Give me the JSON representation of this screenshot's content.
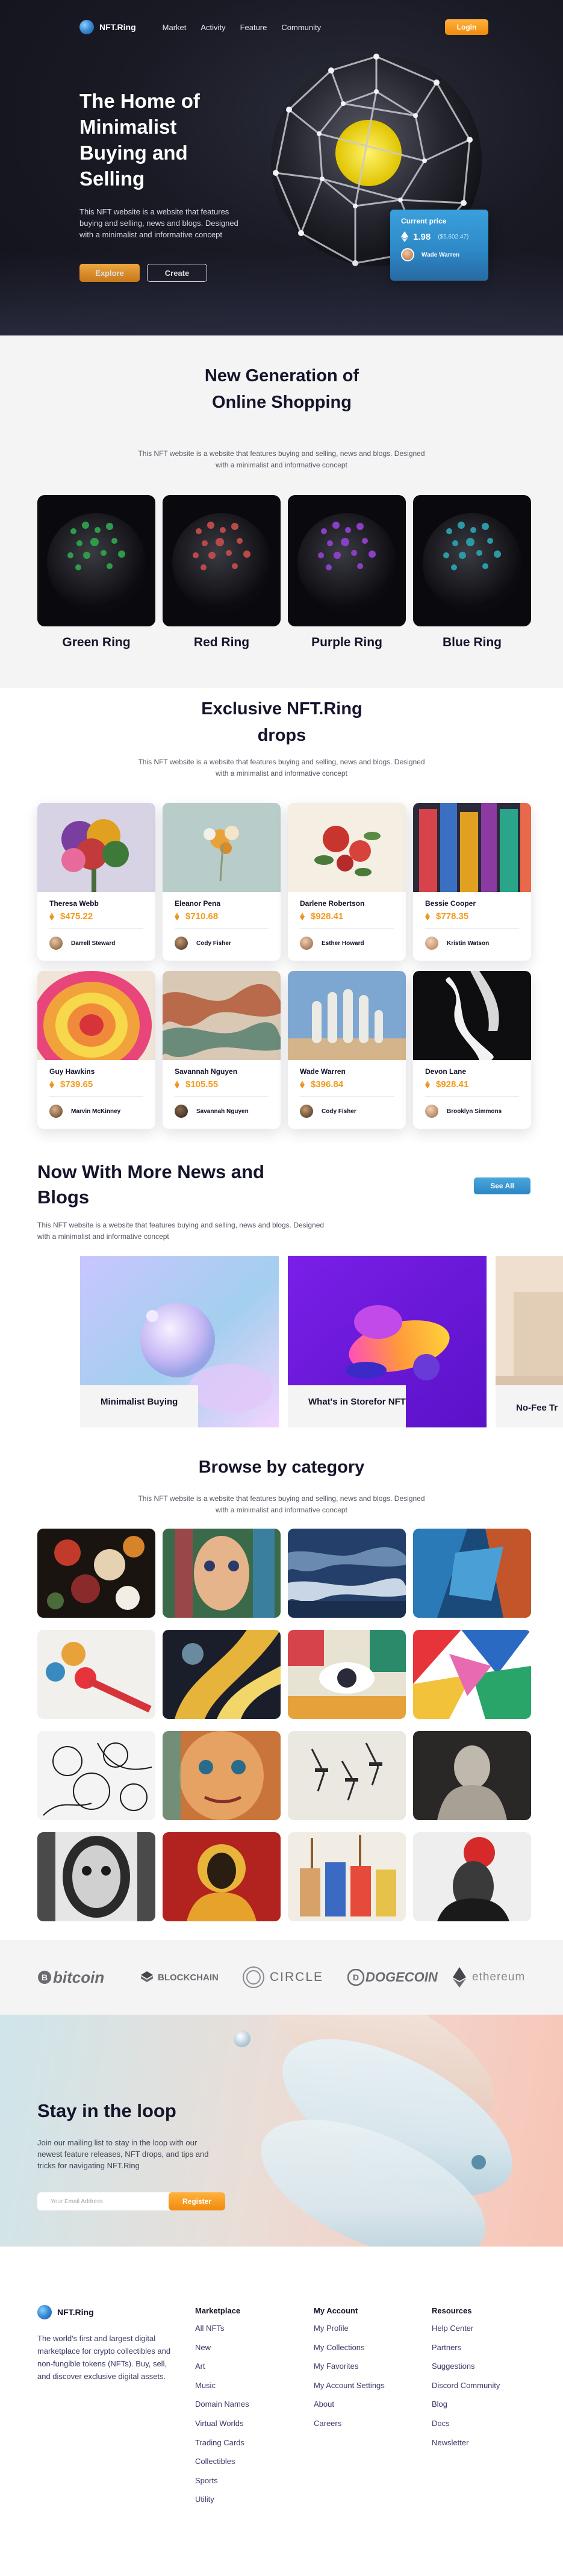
{
  "nav": {
    "brand": "NFT.Ring",
    "links": [
      "Market",
      "Activity",
      "Feature",
      "Community"
    ],
    "login": "Login"
  },
  "hero": {
    "title": "The Home of Minimalist Buying and Selling",
    "description": "This NFT website is a website that features buying and selling, news and blogs. Designed with a minimalist and informative concept",
    "explore": "Explore",
    "create": "Create",
    "price_card": {
      "label": "Current price",
      "eth": "1.98",
      "usd": "($5,602.47)",
      "owner": "Wade Warren"
    }
  },
  "new_generation": {
    "title": "New Generation of Online Shopping",
    "description": "This NFT website is a website that features buying and selling, news and blogs. Designed with a minimalist and informative concept",
    "rings": [
      {
        "name": "Green Ring",
        "color": "#2f9a4a"
      },
      {
        "name": "Red Ring",
        "color": "#b94a4a"
      },
      {
        "name": "Purple Ring",
        "color": "#8a3fc4"
      },
      {
        "name": "Blue Ring",
        "color": "#2a9aa5"
      }
    ]
  },
  "drops": {
    "title": "Exclusive NFT.Ring drops",
    "description": "This NFT website is a website that features buying and selling, news and blogs. Designed with a minimalist and informative concept",
    "items": [
      {
        "name": "Theresa Webb",
        "price": "$475.22",
        "owner": "Darrell Steward"
      },
      {
        "name": "Eleanor Pena",
        "price": "$710.68",
        "owner": "Cody Fisher"
      },
      {
        "name": "Darlene Robertson",
        "price": "$928.41",
        "owner": "Esther Howard"
      },
      {
        "name": "Bessie Cooper",
        "price": "$778.35",
        "owner": "Kristin Watson"
      },
      {
        "name": "Guy Hawkins",
        "price": "$739.65",
        "owner": "Marvin McKinney"
      },
      {
        "name": "Savannah Nguyen",
        "price": "$105.55",
        "owner": "Savannah Nguyen"
      },
      {
        "name": "Wade Warren",
        "price": "$396.84",
        "owner": "Cody Fisher"
      },
      {
        "name": "Devon Lane",
        "price": "$928.41",
        "owner": "Brooklyn Simmons"
      }
    ]
  },
  "news": {
    "title": "Now With More News and Blogs",
    "description": "This NFT website is a website that features buying and selling, news and blogs. Designed with a minimalist and informative concept",
    "see_all": "See All",
    "cards": [
      "Minimalist Buying",
      "What's in Storefor NFT",
      "No-Fee Tr"
    ]
  },
  "category": {
    "title": "Browse by category",
    "description": "This NFT website is a website that features buying and selling, news and blogs. Designed with a minimalist and informative concept"
  },
  "brands": [
    "bitcoin",
    "BLOCKCHAIN",
    "CIRCLE",
    "DOGECOIN",
    "ethereum"
  ],
  "loop": {
    "title": "Stay in the loop",
    "description": "Join our mailing list to stay in the loop with our newest feature releases, NFT drops, and tips and tricks for navigating NFT.Ring",
    "placeholder": "Your Email Address",
    "button": "Register"
  },
  "footer": {
    "brand": "NFT.Ring",
    "description": "The world's first and largest digital marketplace for crypto collectibles and non-fungible tokens (NFTs). Buy, sell, and discover exclusive digital assets.",
    "columns": [
      {
        "title": "Marketplace",
        "links": [
          "All NFTs",
          "New",
          "Art",
          "Music",
          "Domain Names",
          "Virtual Worlds",
          "Trading Cards",
          "Collectibles",
          "Sports",
          "Utility"
        ]
      },
      {
        "title": "My Account",
        "links": [
          "My Profile",
          "My Collections",
          "My Favorites",
          "My Account Settings",
          "About",
          "Careers"
        ]
      },
      {
        "title": "Resources",
        "links": [
          "Help Center",
          "Partners",
          "Suggestions",
          "Discord Community",
          "Blog",
          "Docs",
          "Newsletter"
        ]
      }
    ]
  },
  "colors": {
    "accent_orange": "#f39a1e",
    "accent_blue": "#2b86c3",
    "hero_bg": "#191a24",
    "section_gray": "#f4f4f4"
  }
}
